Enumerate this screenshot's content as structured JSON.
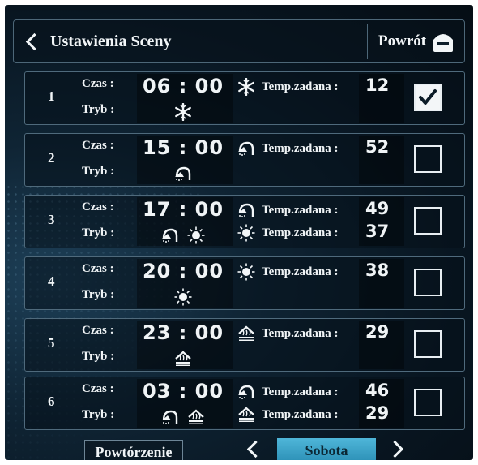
{
  "header": {
    "title": "Ustawienia Sceny",
    "back_label": "Powrót"
  },
  "labels": {
    "czas": "Czas :",
    "tryb": "Tryb :",
    "temp": "Temp.zadana :"
  },
  "scenes": [
    {
      "index": "1",
      "time": "06 : 00",
      "modes": [
        "snowflake-icon"
      ],
      "temps": [
        {
          "mode": "snowflake-icon",
          "value": "12"
        }
      ],
      "checked": true
    },
    {
      "index": "2",
      "time": "15 : 00",
      "modes": [
        "shower-icon"
      ],
      "temps": [
        {
          "mode": "shower-icon",
          "value": "52"
        }
      ],
      "checked": false
    },
    {
      "index": "3",
      "time": "17 : 00",
      "modes": [
        "shower-icon",
        "sun-icon"
      ],
      "temps": [
        {
          "mode": "shower-icon",
          "value": "49"
        },
        {
          "mode": "sun-icon",
          "value": "37"
        }
      ],
      "checked": false
    },
    {
      "index": "4",
      "time": "20 : 00",
      "modes": [
        "sun-icon"
      ],
      "temps": [
        {
          "mode": "sun-icon",
          "value": "38"
        }
      ],
      "checked": false
    },
    {
      "index": "5",
      "time": "23 : 00",
      "modes": [
        "floor-heating-icon"
      ],
      "temps": [
        {
          "mode": "floor-heating-icon",
          "value": "29"
        }
      ],
      "checked": false
    },
    {
      "index": "6",
      "time": "03 : 00",
      "modes": [
        "shower-icon",
        "floor-heating-icon"
      ],
      "temps": [
        {
          "mode": "shower-icon",
          "value": "46"
        },
        {
          "mode": "floor-heating-icon",
          "value": "29"
        }
      ],
      "checked": false
    }
  ],
  "footer": {
    "repeat_label": "Powtórzenie",
    "day_label": "Sobota"
  },
  "colors": {
    "accent": "#3aa6cc",
    "text": "#f0f4f6"
  }
}
